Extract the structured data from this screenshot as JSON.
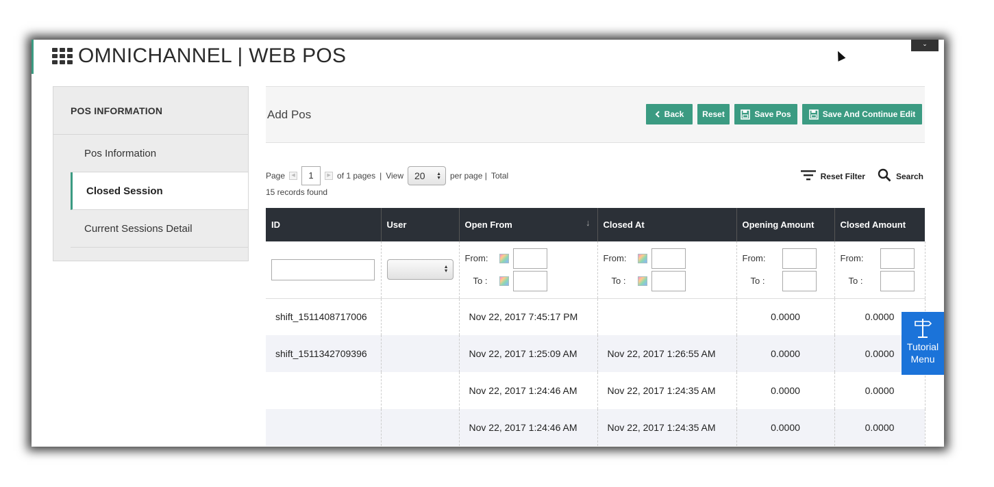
{
  "app": {
    "title": "OMNICHANNEL | WEB POS",
    "top_corner_glyph": "⌄"
  },
  "sidebar": {
    "heading": "POS INFORMATION",
    "items": [
      {
        "label": "Pos Information",
        "active": false
      },
      {
        "label": "Closed Session",
        "active": true
      },
      {
        "label": "Current Sessions Detail",
        "active": false
      }
    ]
  },
  "panel": {
    "title": "Add Pos",
    "buttons": {
      "back": "Back",
      "reset": "Reset",
      "save": "Save Pos",
      "save_continue": "Save And Continue Edit"
    }
  },
  "pager": {
    "page_label": "Page",
    "page_value": "1",
    "of_pages": "of 1 pages",
    "sep": "|",
    "view_label": "View",
    "view_value": "20",
    "per_page": "per page |",
    "total": "Total",
    "records_found": "15 records found"
  },
  "filter_tools": {
    "reset_filter": "Reset Filter",
    "search": "Search"
  },
  "table": {
    "columns": [
      "ID",
      "User",
      "Open From",
      "Closed At",
      "Opening Amount",
      "Closed Amount"
    ],
    "sort_icon": "↓",
    "filters": {
      "from": "From:",
      "to": "To :"
    },
    "rows": [
      [
        "shift_1511408717006",
        "",
        "Nov 22, 2017 7:45:17 PM",
        "",
        "0.0000",
        "0.0000"
      ],
      [
        "shift_1511342709396",
        "",
        "Nov 22, 2017 1:25:09 AM",
        "Nov 22, 2017 1:26:55 AM",
        "0.0000",
        "0.0000"
      ],
      [
        "",
        "",
        "Nov 22, 2017 1:24:46 AM",
        "Nov 22, 2017 1:24:35 AM",
        "0.0000",
        "0.0000"
      ],
      [
        "",
        "",
        "Nov 22, 2017 1:24:46 AM",
        "Nov 22, 2017 1:24:35 AM",
        "0.0000",
        "0.0000"
      ]
    ]
  },
  "tutorial": {
    "line1": "Tutorial",
    "line2": "Menu"
  },
  "colors": {
    "accent": "#3b9b82",
    "header_bg": "#2b3037",
    "tutorial_bg": "#1b73d9"
  }
}
